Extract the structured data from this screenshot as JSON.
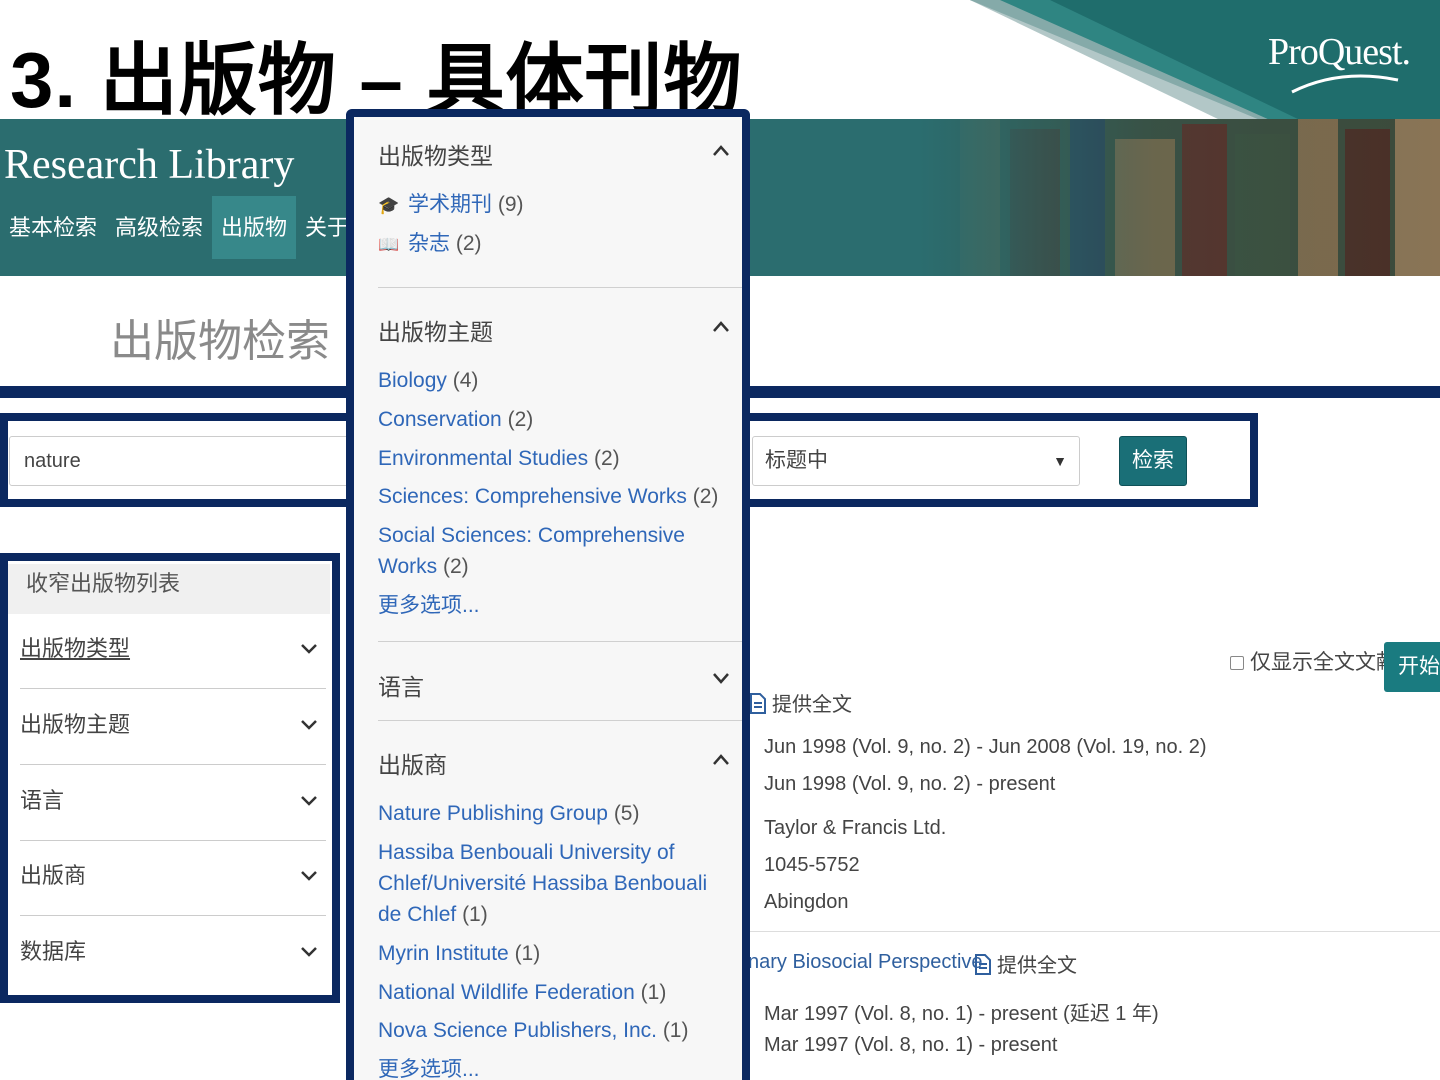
{
  "slide": {
    "title": "3. 出版物 – 具体刊物",
    "logo": "ProQuest."
  },
  "app": {
    "brand": "Research Library",
    "nav": [
      "基本检索",
      "高级检索",
      "出版物",
      "关于"
    ],
    "active_nav": "出版物",
    "page_heading": "出版物检索",
    "header_color": "#2b6d6f",
    "frame_color": "#0b2860"
  },
  "search": {
    "query": "nature",
    "scope": "标题中",
    "button": "检索"
  },
  "narrow": {
    "heading": "收窄出版物列表",
    "sections": [
      "出版物类型",
      "出版物主题",
      "语言",
      "出版商",
      "数据库"
    ]
  },
  "filter_panel": {
    "pub_type": {
      "title": "出版物类型",
      "items": [
        {
          "icon": "graduation-cap-icon",
          "label": "学术期刊",
          "count": "(9)"
        },
        {
          "icon": "open-book-icon",
          "label": "杂志",
          "count": "(2)"
        }
      ]
    },
    "subject": {
      "title": "出版物主题",
      "items": [
        {
          "label": "Biology",
          "count": "(4)"
        },
        {
          "label": "Conservation",
          "count": "(2)"
        },
        {
          "label": "Environmental Studies",
          "count": "(2)"
        },
        {
          "label": "Sciences: Comprehensive Works",
          "count": "(2)"
        },
        {
          "label": "Social Sciences: Comprehensive Works",
          "count": "(2)"
        }
      ],
      "more": "更多选项..."
    },
    "language": {
      "title": "语言"
    },
    "publisher": {
      "title": "出版商",
      "items": [
        {
          "label": "Nature Publishing Group",
          "count": "(5)"
        },
        {
          "label": "Hassiba Benbouali University of Chlef/Université Hassiba Benbouali de Chlef",
          "count": "(1)"
        },
        {
          "label": "Myrin Institute",
          "count": "(1)"
        },
        {
          "label": "National Wildlife Federation",
          "count": "(1)"
        },
        {
          "label": "Nova Science Publishers, Inc.",
          "count": "(1)"
        }
      ],
      "more": "更多选项..."
    }
  },
  "results": {
    "fulltext_only": "仅显示全文文献",
    "start": "开始",
    "item1": {
      "fulltext": "提供全文",
      "coverage1": "Jun 1998 (Vol. 9, no. 2) - Jun 2008 (Vol. 19, no. 2)",
      "coverage2": "Jun 1998 (Vol. 9, no. 2) - present",
      "publisher": "Taylor & Francis Ltd.",
      "issn": "1045-5752",
      "place": "Abingdon"
    },
    "item2": {
      "title_fragment": "nary Biosocial Perspective",
      "fulltext": "提供全文",
      "coverage1": "Mar 1997 (Vol. 8, no. 1) - present (延迟 1 年)",
      "coverage2": "Mar 1997 (Vol. 8, no. 1) - present"
    }
  }
}
